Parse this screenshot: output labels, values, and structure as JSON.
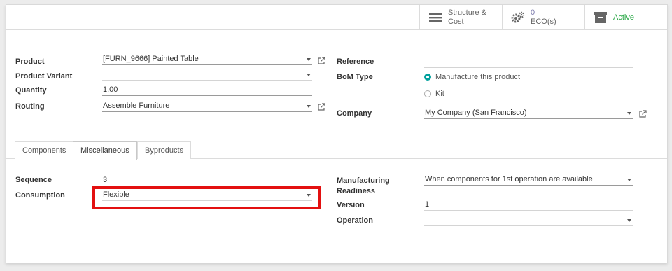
{
  "stat_buttons": {
    "structure_label_1": "Structure &",
    "structure_label_2": "Cost",
    "eco_count": "0",
    "eco_label": "ECO(s)",
    "active_label": "Active",
    "active_color": "#28a745"
  },
  "form": {
    "product_label": "Product",
    "product_value": "[FURN_9666] Painted Table",
    "variant_label": "Product Variant",
    "variant_value": "",
    "quantity_label": "Quantity",
    "quantity_value": "1.00",
    "routing_label": "Routing",
    "routing_value": "Assemble Furniture",
    "reference_label": "Reference",
    "reference_value": "",
    "bom_type_label": "BoM Type",
    "bom_type_options": [
      "Manufacture this product",
      "Kit"
    ],
    "bom_type_selected": "Manufacture this product",
    "company_label": "Company",
    "company_value": "My Company (San Francisco)"
  },
  "tabs": [
    "Components",
    "Miscellaneous",
    "Byproducts"
  ],
  "active_tab": "Miscellaneous",
  "misc": {
    "sequence_label": "Sequence",
    "sequence_value": "3",
    "consumption_label": "Consumption",
    "consumption_value": "Flexible",
    "readiness_label_1": "Manufacturing",
    "readiness_label_2": "Readiness",
    "readiness_value": "When components for 1st operation are available",
    "version_label": "Version",
    "version_value": "1",
    "operation_label": "Operation",
    "operation_value": ""
  },
  "highlight_color": "#e31010"
}
